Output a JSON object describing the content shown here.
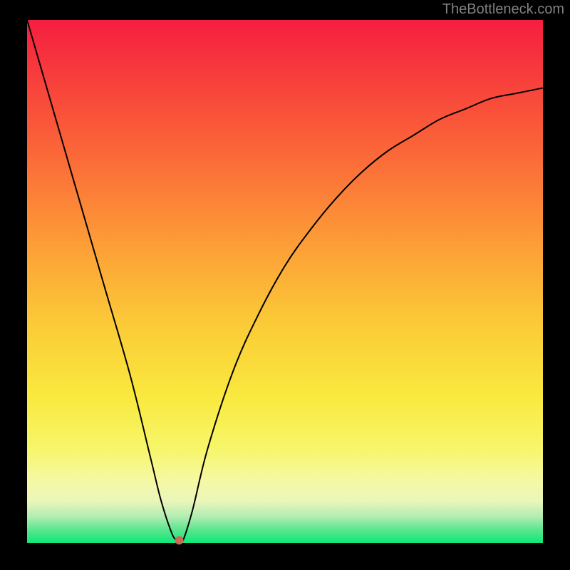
{
  "watermark": "TheBottleneck.com",
  "chart_data": {
    "type": "line",
    "title": "",
    "xlabel": "",
    "ylabel": "",
    "xlim": [
      0,
      100
    ],
    "ylim": [
      0,
      100
    ],
    "grid": false,
    "legend": false,
    "series": [
      {
        "name": "bottleneck-curve",
        "x": [
          0,
          5,
          10,
          15,
          20,
          24,
          26,
          28,
          29,
          30,
          32,
          35,
          40,
          45,
          50,
          55,
          60,
          65,
          70,
          75,
          80,
          85,
          90,
          95,
          100
        ],
        "y": [
          100,
          83,
          66,
          49,
          32,
          16,
          8,
          2,
          0.5,
          0,
          6,
          18,
          33,
          44,
          53,
          60,
          66,
          71,
          75,
          78,
          81,
          83,
          85,
          86,
          87
        ]
      }
    ],
    "marker": {
      "x": 29.5,
      "y": 0.5,
      "color": "#c96a55"
    },
    "background_gradient": {
      "stops": [
        {
          "pos": 0.0,
          "color": "#f51e40"
        },
        {
          "pos": 0.25,
          "color": "#fb6638"
        },
        {
          "pos": 0.58,
          "color": "#fbca37"
        },
        {
          "pos": 0.82,
          "color": "#f7f66a"
        },
        {
          "pos": 0.95,
          "color": "#b1edb1"
        },
        {
          "pos": 1.0,
          "color": "#0de879"
        }
      ]
    }
  }
}
